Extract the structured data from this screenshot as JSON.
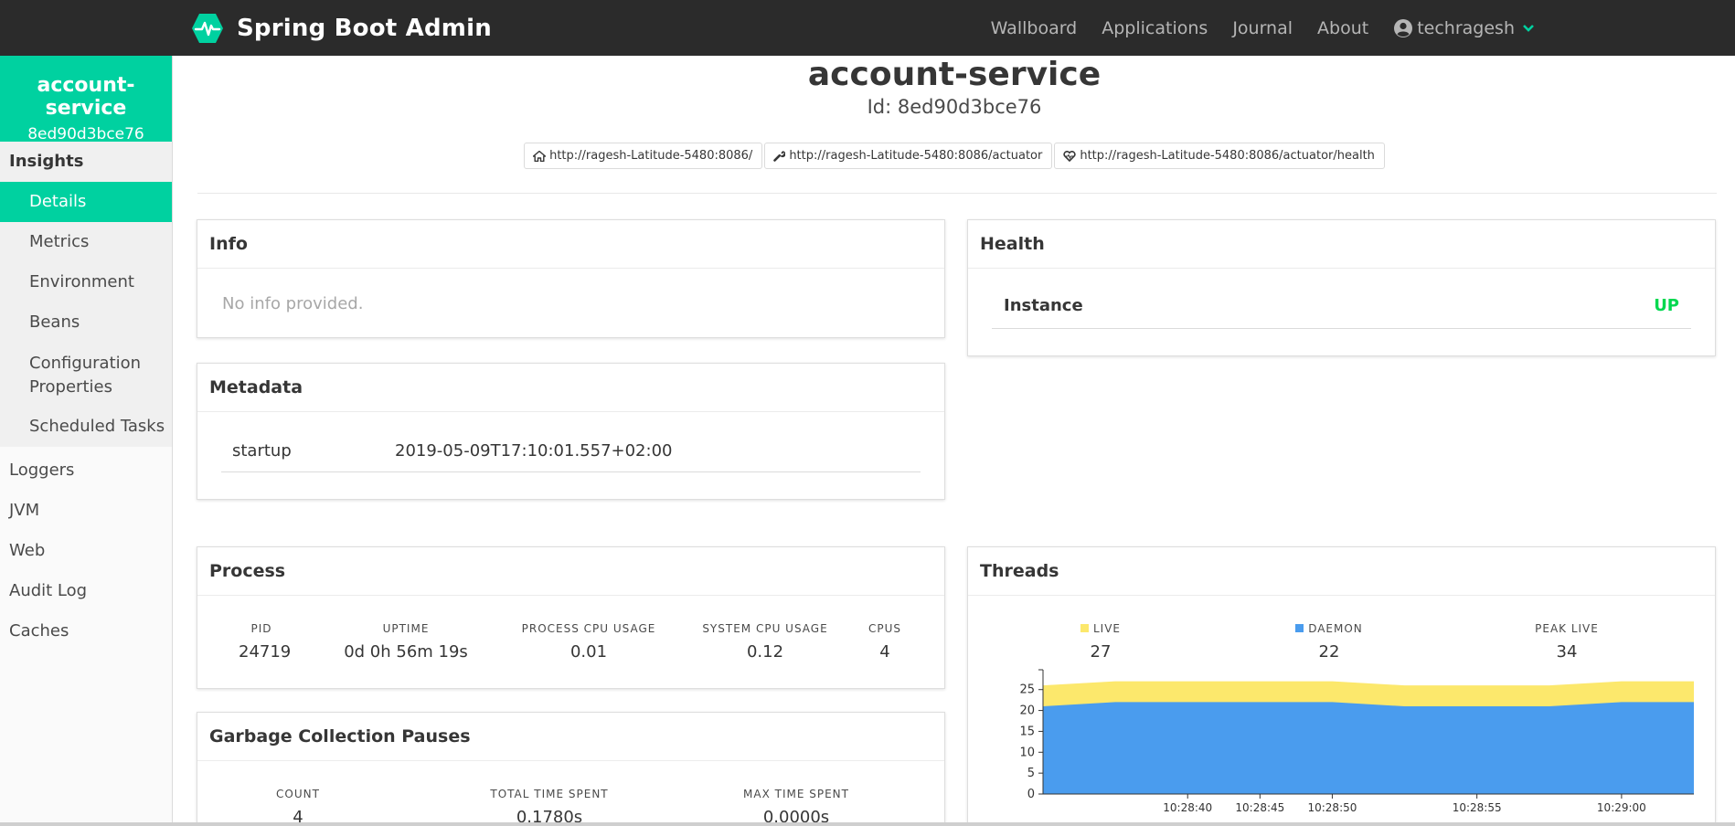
{
  "navbar": {
    "brand": "Spring Boot Admin",
    "items": [
      "Wallboard",
      "Applications",
      "Journal",
      "About"
    ],
    "user": "techragesh",
    "colors": {
      "background": "#2b2b2b",
      "accent": "#00d1a0"
    },
    "icons": {
      "brand": "heartbeat-icon",
      "user": "user-circle-icon",
      "dropdown": "chevron-down-icon"
    }
  },
  "sidebar": {
    "app_name": "account-service",
    "app_id": "8ed90d3bce76",
    "group_title": "Insights",
    "group_items": [
      "Details",
      "Metrics",
      "Environment",
      "Beans",
      "Configuration Properties",
      "Scheduled Tasks"
    ],
    "active_item": "Details",
    "items": [
      "Loggers",
      "JVM",
      "Web",
      "Audit Log",
      "Caches"
    ]
  },
  "header": {
    "title": "account-service",
    "subtitle": "Id: 8ed90d3bce76",
    "links": [
      {
        "icon": "home-icon",
        "url": "http://ragesh-Latitude-5480:8086/"
      },
      {
        "icon": "wrench-icon",
        "url": "http://ragesh-Latitude-5480:8086/actuator"
      },
      {
        "icon": "heart-icon",
        "url": "http://ragesh-Latitude-5480:8086/actuator/health"
      }
    ]
  },
  "info": {
    "title": "Info",
    "empty_text": "No info provided."
  },
  "metadata": {
    "title": "Metadata",
    "rows": [
      {
        "key": "startup",
        "value": "2019-05-09T17:10:01.557+02:00"
      }
    ]
  },
  "health": {
    "title": "Health",
    "key": "Instance",
    "status": "UP",
    "status_color": "#00d84f"
  },
  "process": {
    "title": "Process",
    "stats": [
      {
        "label": "PID",
        "value": "24719"
      },
      {
        "label": "UPTIME",
        "value": "0d 0h 56m 19s"
      },
      {
        "label": "PROCESS CPU USAGE",
        "value": "0.01"
      },
      {
        "label": "SYSTEM CPU USAGE",
        "value": "0.12"
      },
      {
        "label": "CPUS",
        "value": "4"
      }
    ]
  },
  "gc": {
    "title": "Garbage Collection Pauses",
    "stats": [
      {
        "label": "COUNT",
        "value": "4"
      },
      {
        "label": "TOTAL TIME SPENT",
        "value": "0.1780s"
      },
      {
        "label": "MAX TIME SPENT",
        "value": "0.0000s"
      }
    ]
  },
  "threads": {
    "title": "Threads",
    "stats": [
      {
        "label": "LIVE",
        "value": "27",
        "color": "#fce86c"
      },
      {
        "label": "DAEMON",
        "value": "22",
        "color": "#4a9cee"
      },
      {
        "label": "PEAK LIVE",
        "value": "34"
      }
    ]
  },
  "chart_data": {
    "type": "area",
    "x": [
      "10:28:35",
      "10:28:38",
      "10:28:40",
      "10:28:45",
      "10:28:50",
      "10:28:53",
      "10:28:55",
      "10:28:58",
      "10:29:00",
      "10:29:02"
    ],
    "xticks": [
      "10:28:40",
      "10:28:45",
      "10:28:50",
      "10:28:55",
      "10:29:00"
    ],
    "yticks": [
      0,
      5,
      10,
      15,
      20,
      25
    ],
    "ylim": [
      0,
      28
    ],
    "series": [
      {
        "name": "LIVE",
        "color": "#fce86c",
        "values": [
          26,
          27,
          27,
          27,
          27,
          26,
          26,
          26,
          27,
          27
        ]
      },
      {
        "name": "DAEMON",
        "color": "#4a9cee",
        "values": [
          21,
          22,
          22,
          22,
          22,
          21,
          21,
          21,
          22,
          22
        ]
      }
    ]
  }
}
